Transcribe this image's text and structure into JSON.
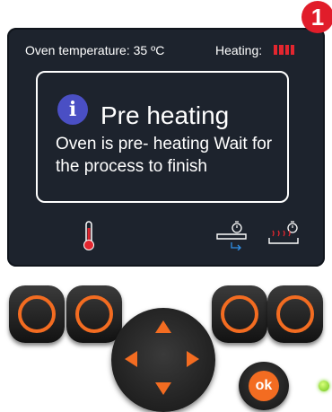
{
  "step": {
    "number": "1",
    "color": "#e11d2a"
  },
  "status": {
    "temperature_label": "Oven temperature: 35 ºC",
    "heating_label": "Heating:",
    "heating_level_bars": 4,
    "heating_color": "#e3262f"
  },
  "dialog": {
    "icon": "info-icon",
    "icon_letter": "i",
    "title": "Pre heating",
    "body": "Oven is pre- heating Wait for the process to finish"
  },
  "screen_icons": [
    "thermometer-icon",
    "timer-tray-icon",
    "timer-heat-icon"
  ],
  "controls": {
    "ok_label": "ok",
    "accent_color": "#f36c21",
    "led": "status-led"
  }
}
